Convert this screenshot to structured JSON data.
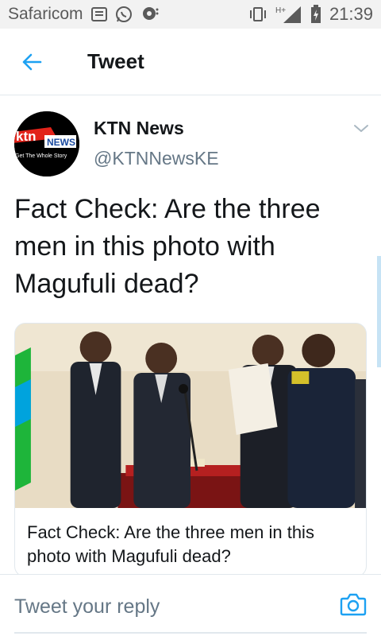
{
  "status_bar": {
    "carrier": "Safaricom",
    "network": "H+",
    "time": "21:39"
  },
  "app_bar": {
    "title": "Tweet",
    "back_icon": "arrow-left-icon"
  },
  "tweet": {
    "author_name": "KTN News",
    "author_handle": "@KTNNewsKE",
    "avatar": {
      "logo_text": "ktn",
      "logo_badge": "NEWS",
      "tagline": "Get The Whole Story"
    },
    "text": "Fact Check: Are the three men in this photo with Magufuli dead?",
    "card": {
      "title": "Fact Check: Are the three men in this photo with Magufuli dead?"
    }
  },
  "reply": {
    "placeholder": "Tweet your reply",
    "camera_icon": "camera-icon"
  },
  "colors": {
    "accent": "#1da1f2",
    "secondary_text": "#657786",
    "divider": "#e1e8ed"
  }
}
